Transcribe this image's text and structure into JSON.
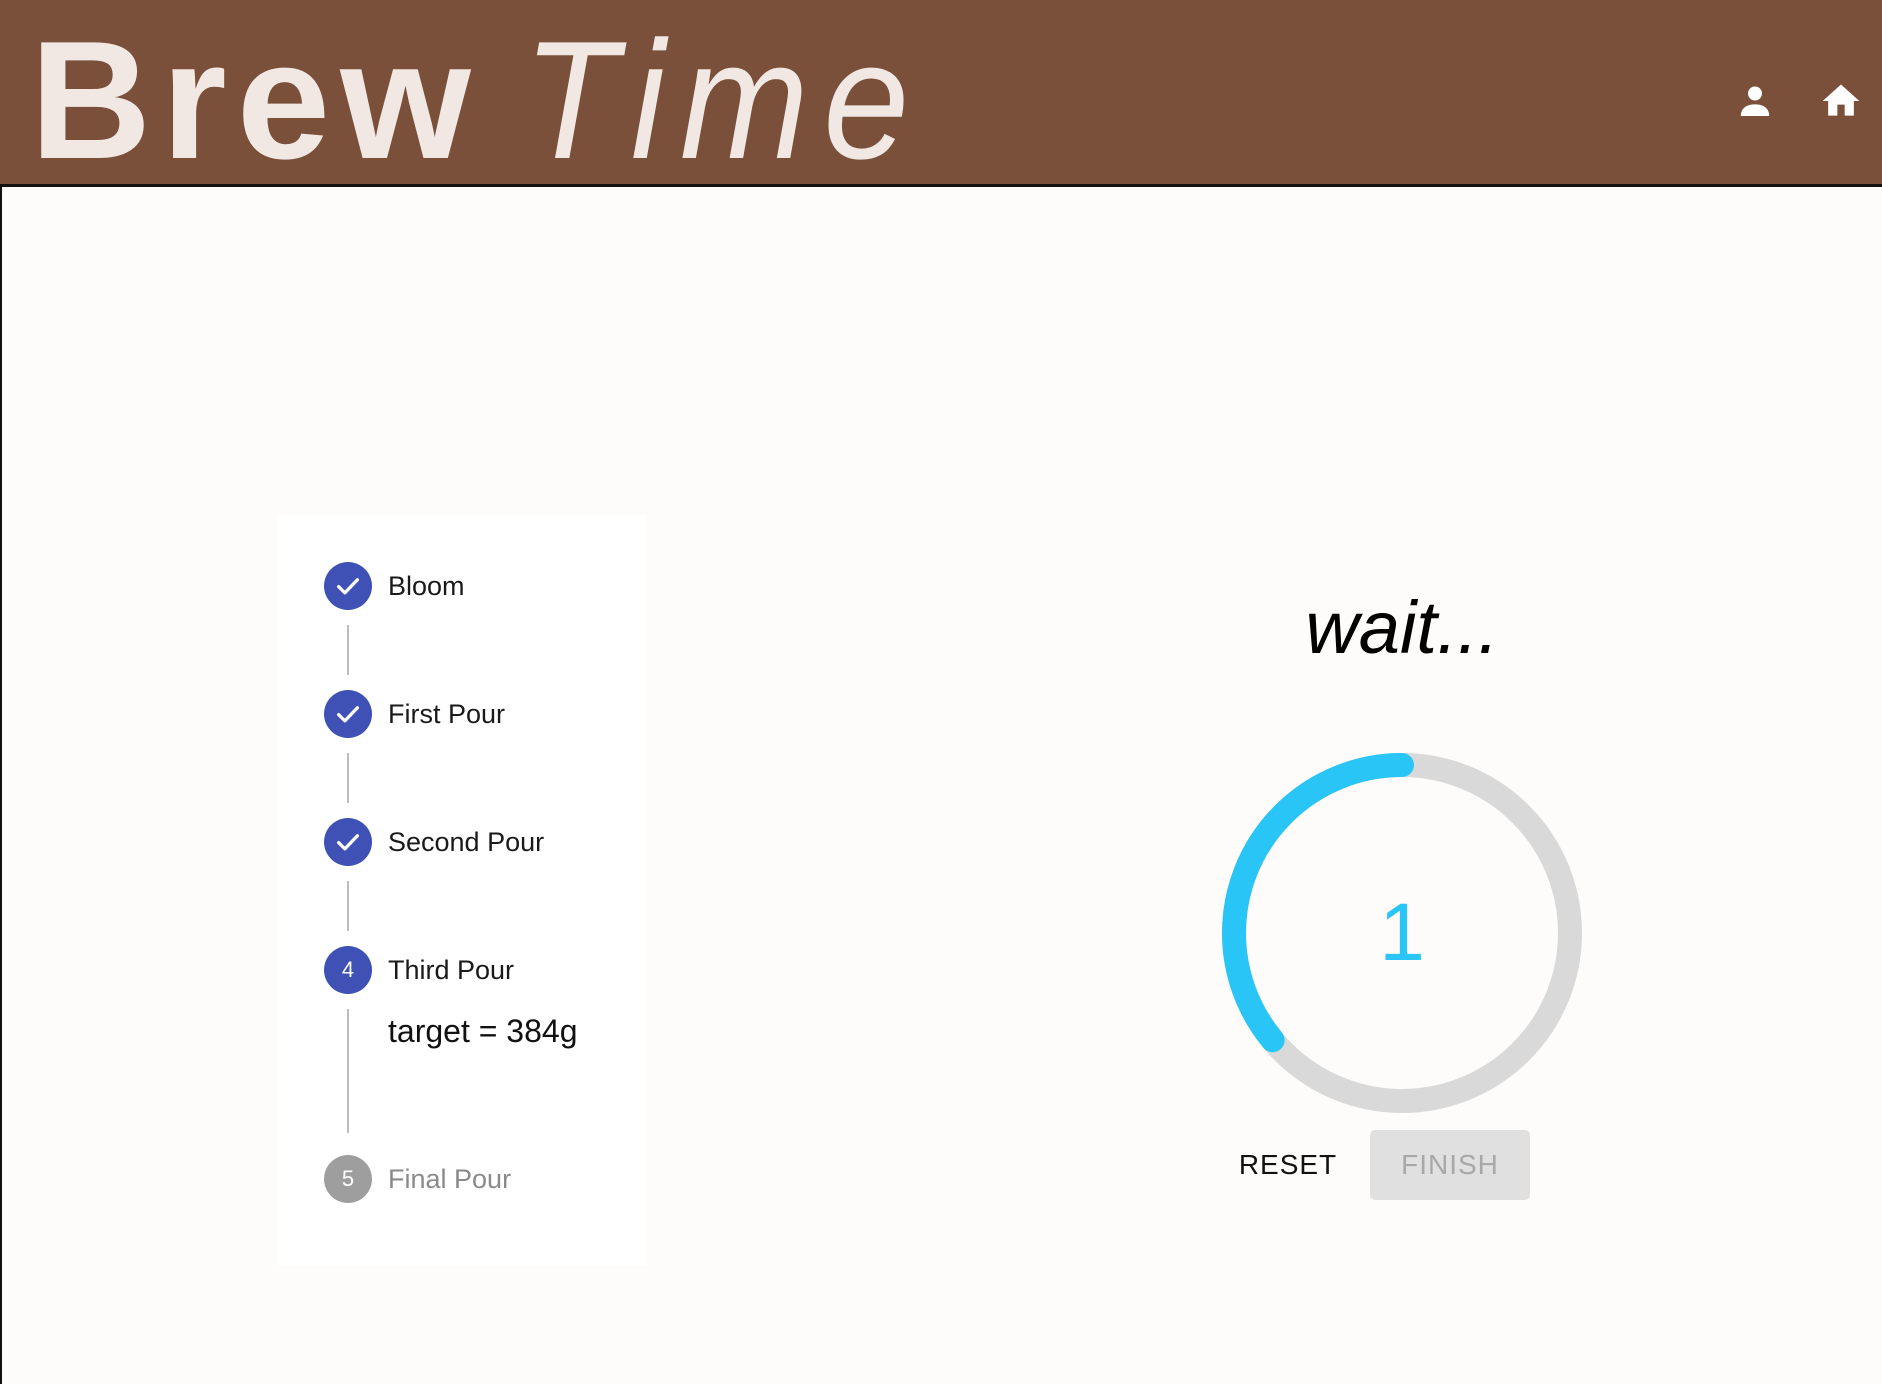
{
  "app": {
    "title_bold": "Brew",
    "title_light": "Time",
    "bar_color": "#7b503a",
    "icons": [
      "person-icon",
      "home-icon"
    ]
  },
  "stepper": {
    "steps": [
      {
        "label": "Bloom",
        "state": "completed",
        "icon": "check-icon"
      },
      {
        "label": "First Pour",
        "state": "completed",
        "icon": "check-icon"
      },
      {
        "label": "Second Pour",
        "state": "completed",
        "icon": "check-icon"
      },
      {
        "label": "Third Pour",
        "state": "active",
        "number": "4"
      },
      {
        "label": "Final Pour",
        "state": "inactive",
        "number": "5"
      }
    ],
    "active_content": "target = 384g",
    "active_color": "#3f51b5",
    "inactive_color": "#9e9e9e"
  },
  "timer": {
    "status": "wait...",
    "value": "1",
    "progress_fraction": 0.36,
    "progress_color": "#29c5f6",
    "track_color": "#d9d9d9"
  },
  "actions": {
    "reset_label": "RESET",
    "finish_label": "FINISH"
  }
}
